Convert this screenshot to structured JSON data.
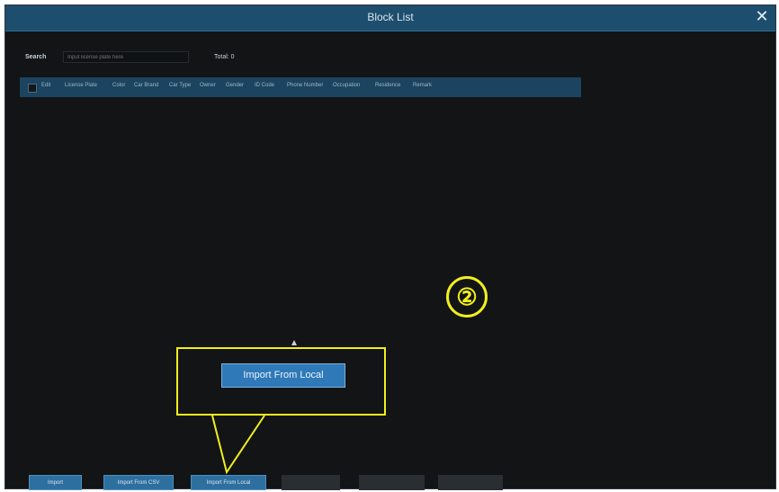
{
  "window": {
    "title": "Block List"
  },
  "search": {
    "label": "Search",
    "placeholder": "Input license plate here",
    "total": "Total: 0"
  },
  "table": {
    "columns": [
      "Edit",
      "License Plate",
      "Color",
      "Car Brand",
      "Car Type",
      "Owner",
      "Gender",
      "ID Code",
      "Phone Number",
      "Occupation",
      "Residence",
      "Remark"
    ]
  },
  "callout": {
    "marker": "②",
    "button_label": "Import From Local"
  },
  "buttons": [
    "Import",
    "Import From CSV",
    "Import From Local",
    "",
    "",
    ""
  ],
  "colors": {
    "accent": "#2d6f9f",
    "highlight": "#f2ef1c",
    "background": "#121416"
  }
}
